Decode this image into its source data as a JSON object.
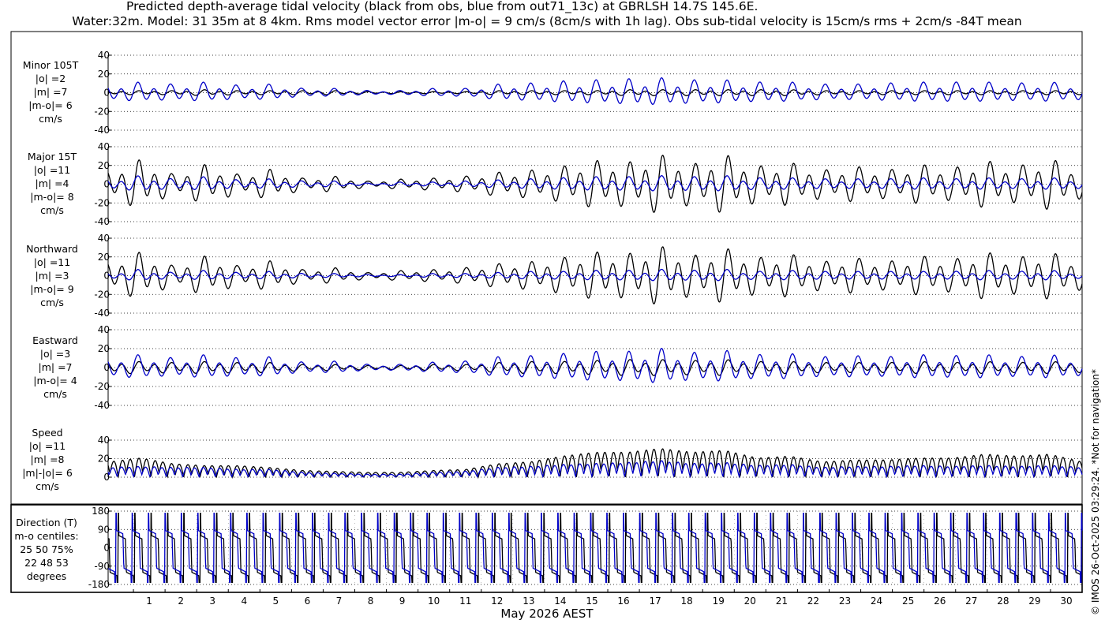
{
  "figure": {
    "title_line1": "Predicted depth-average tidal velocity (black from obs, blue from out71_13c) at GBRLSH 14.7S 145.6E.",
    "title_line2": "Water:32m. Model: 31 35m at 8 4km. Rms model vector error |m-o| = 9 cm/s (8cm/s with 1h lag). Obs sub-tidal velocity is 15cm/s rms + 2cm/s -84T mean",
    "xlabel": "May 2026 AEST",
    "credit": "© IMOS 26-Oct-2025 03:29:24. *Not for navigation*",
    "colors": {
      "obs": "#000000",
      "model": "#0000c8"
    }
  },
  "chart_data": [
    {
      "type": "line",
      "panel": "minor",
      "label_lines": [
        "Minor 105T",
        "|o| =2",
        "|m| =7",
        "|m-o|= 6",
        "cm/s"
      ],
      "ylim": [
        -40,
        40
      ],
      "yticks": [
        -40,
        -20,
        0,
        20,
        40
      ],
      "grid": true,
      "obs_amp": 2,
      "model_amp": 7,
      "series": [
        {
          "role": "obs",
          "values": [
            2,
            0,
            -2,
            0,
            2,
            0,
            -3,
            0,
            2,
            0,
            -2,
            0,
            2,
            0,
            -2,
            0,
            1,
            0,
            -1,
            0,
            1,
            0,
            -1,
            0,
            2,
            0,
            -2,
            0,
            2,
            0,
            -2,
            0,
            3,
            0,
            -3,
            0,
            3,
            0,
            -3,
            0,
            3,
            0,
            -3,
            0,
            2,
            0,
            -2,
            0,
            2,
            0,
            -2,
            0,
            2,
            0,
            -2,
            0,
            2,
            0,
            -2,
            0,
            2,
            0
          ]
        },
        {
          "role": "model",
          "values": [
            8,
            0,
            -10,
            0,
            8,
            0,
            -10,
            0,
            7,
            0,
            -8,
            0,
            4,
            0,
            -4,
            0,
            2,
            0,
            -2,
            0,
            4,
            0,
            -4,
            0,
            8,
            0,
            -9,
            0,
            11,
            0,
            -12,
            0,
            13,
            0,
            -14,
            0,
            12,
            0,
            -12,
            0,
            10,
            0,
            -10,
            0,
            8,
            0,
            -8,
            0,
            9,
            0,
            -10,
            0,
            10,
            0,
            -10,
            0,
            9,
            0,
            -10,
            0,
            8,
            0
          ]
        }
      ]
    },
    {
      "type": "line",
      "panel": "major",
      "label_lines": [
        "Major 15T",
        "|o| =11",
        "|m| =4",
        "|m-o|= 8",
        "cm/s"
      ],
      "ylim": [
        -40,
        40
      ],
      "yticks": [
        -40,
        -20,
        0,
        20,
        40
      ],
      "grid": true,
      "obs_amp": 11,
      "model_amp": 4,
      "series": [
        {
          "role": "obs",
          "values": [
            14,
            0,
            -25,
            0,
            10,
            0,
            -20,
            0,
            10,
            0,
            -15,
            0,
            6,
            0,
            -8,
            0,
            3,
            0,
            -5,
            0,
            6,
            0,
            -8,
            0,
            12,
            0,
            -14,
            0,
            18,
            0,
            -24,
            0,
            22,
            0,
            -30,
            0,
            20,
            0,
            -30,
            0,
            18,
            0,
            -22,
            0,
            14,
            0,
            -18,
            0,
            14,
            0,
            -20,
            0,
            16,
            0,
            -24,
            0,
            18,
            0,
            -26,
            0,
            14,
            0
          ]
        },
        {
          "role": "model",
          "values": [
            5,
            0,
            -8,
            0,
            5,
            0,
            -7,
            0,
            4,
            0,
            -5,
            0,
            3,
            0,
            -3,
            0,
            1,
            0,
            -2,
            0,
            2,
            0,
            -3,
            0,
            4,
            0,
            -5,
            0,
            6,
            0,
            -7,
            0,
            7,
            0,
            -8,
            0,
            7,
            0,
            -8,
            0,
            6,
            0,
            -6,
            0,
            5,
            0,
            -5,
            0,
            5,
            0,
            -6,
            0,
            5,
            0,
            -6,
            0,
            5,
            0,
            -6,
            0,
            5,
            0
          ]
        }
      ]
    },
    {
      "type": "line",
      "panel": "northward",
      "label_lines": [
        "Northward",
        "|o| =11",
        "|m| =3",
        "|m-o|= 9",
        "cm/s"
      ],
      "ylim": [
        -40,
        40
      ],
      "yticks": [
        -40,
        -20,
        0,
        20,
        40
      ],
      "grid": true,
      "obs_amp": 11,
      "model_amp": 3,
      "series": [
        {
          "role": "obs",
          "values": [
            14,
            0,
            -24,
            0,
            10,
            0,
            -20,
            0,
            10,
            0,
            -15,
            0,
            6,
            0,
            -8,
            0,
            3,
            0,
            -5,
            0,
            6,
            0,
            -8,
            0,
            12,
            0,
            -14,
            0,
            18,
            0,
            -24,
            0,
            22,
            0,
            -30,
            0,
            20,
            0,
            -28,
            0,
            18,
            0,
            -22,
            0,
            14,
            0,
            -18,
            0,
            14,
            0,
            -20,
            0,
            16,
            0,
            -24,
            0,
            18,
            0,
            -24,
            0,
            14,
            0
          ]
        },
        {
          "role": "model",
          "values": [
            3,
            0,
            -6,
            0,
            3,
            0,
            -5,
            0,
            3,
            0,
            -4,
            0,
            2,
            0,
            -2,
            0,
            1,
            0,
            -1,
            0,
            2,
            0,
            -2,
            0,
            3,
            0,
            -4,
            0,
            4,
            0,
            -5,
            0,
            5,
            0,
            -6,
            0,
            5,
            0,
            -6,
            0,
            4,
            0,
            -5,
            0,
            4,
            0,
            -4,
            0,
            4,
            0,
            -4,
            0,
            4,
            0,
            -5,
            0,
            4,
            0,
            -5,
            0,
            3,
            0
          ]
        }
      ]
    },
    {
      "type": "line",
      "panel": "eastward",
      "label_lines": [
        "Eastward",
        "|o| =3",
        "|m| =7",
        "|m-o|= 4",
        "cm/s"
      ],
      "ylim": [
        -40,
        40
      ],
      "yticks": [
        -40,
        -20,
        0,
        20,
        40
      ],
      "grid": true,
      "obs_amp": 3,
      "model_amp": 7,
      "series": [
        {
          "role": "obs",
          "values": [
            6,
            0,
            -6,
            0,
            5,
            0,
            -6,
            0,
            5,
            0,
            -5,
            0,
            3,
            0,
            -3,
            0,
            2,
            0,
            -2,
            0,
            3,
            0,
            -3,
            0,
            5,
            0,
            -6,
            0,
            6,
            0,
            -7,
            0,
            8,
            0,
            -8,
            0,
            7,
            0,
            -8,
            0,
            6,
            0,
            -6,
            0,
            5,
            0,
            -5,
            0,
            5,
            0,
            -6,
            0,
            5,
            0,
            -6,
            0,
            5,
            0,
            -6,
            0,
            5,
            0
          ]
        },
        {
          "role": "model",
          "values": [
            10,
            0,
            -12,
            0,
            9,
            0,
            -12,
            0,
            9,
            0,
            -10,
            0,
            5,
            0,
            -6,
            0,
            3,
            0,
            -3,
            0,
            5,
            0,
            -6,
            0,
            10,
            0,
            -11,
            0,
            13,
            0,
            -15,
            0,
            15,
            0,
            -18,
            0,
            14,
            0,
            -16,
            0,
            12,
            0,
            -13,
            0,
            10,
            0,
            -11,
            0,
            10,
            0,
            -12,
            0,
            11,
            0,
            -12,
            0,
            10,
            0,
            -12,
            0,
            9,
            0
          ]
        }
      ]
    },
    {
      "type": "line",
      "panel": "speed",
      "label_lines": [
        "Speed",
        "|o| =11",
        "|m| =8",
        "|m|-|o|= 6",
        "cm/s"
      ],
      "ylim": [
        0,
        40
      ],
      "yticks": [
        0,
        20,
        40
      ],
      "grid": true,
      "obs_amp": 11,
      "model_amp": 8,
      "series": [
        {
          "role": "obs",
          "values": [
            16,
            2,
            20,
            2,
            14,
            2,
            12,
            2,
            12,
            2,
            10,
            2,
            7,
            2,
            6,
            2,
            5,
            2,
            5,
            2,
            7,
            2,
            8,
            2,
            14,
            2,
            16,
            2,
            22,
            2,
            26,
            2,
            26,
            2,
            30,
            2,
            26,
            2,
            28,
            2,
            20,
            2,
            22,
            2,
            16,
            2,
            18,
            2,
            18,
            2,
            20,
            2,
            20,
            2,
            24,
            2,
            22,
            2,
            24,
            2,
            16,
            2
          ]
        },
        {
          "role": "model",
          "values": [
            10,
            2,
            11,
            2,
            10,
            2,
            10,
            2,
            8,
            2,
            8,
            2,
            5,
            2,
            4,
            2,
            3,
            2,
            3,
            2,
            5,
            2,
            6,
            2,
            10,
            2,
            11,
            2,
            13,
            2,
            14,
            2,
            15,
            2,
            17,
            2,
            14,
            2,
            15,
            2,
            12,
            2,
            13,
            2,
            10,
            2,
            11,
            2,
            11,
            2,
            12,
            2,
            11,
            2,
            12,
            2,
            11,
            2,
            12,
            2,
            10,
            2
          ]
        }
      ]
    },
    {
      "type": "line",
      "panel": "direction",
      "label_lines": [
        "Direction (T)",
        "m-o centiles:",
        "25  50  75%",
        "22  48  53",
        "degrees"
      ],
      "ylim": [
        -180,
        180
      ],
      "yticks": [
        -180,
        -90,
        0,
        90,
        180
      ],
      "grid": true,
      "obs_levels": [
        60,
        -120
      ],
      "model_levels": [
        85,
        -100
      ]
    }
  ],
  "x_axis": {
    "tick_labels": [
      "1",
      "2",
      "3",
      "4",
      "5",
      "6",
      "7",
      "8",
      "9",
      "10",
      "11",
      "12",
      "13",
      "14",
      "15",
      "16",
      "17",
      "18",
      "19",
      "20",
      "21",
      "22",
      "23",
      "24",
      "25",
      "26",
      "27",
      "28",
      "29",
      "30"
    ],
    "day_start": 0.2,
    "day_end": 31
  }
}
